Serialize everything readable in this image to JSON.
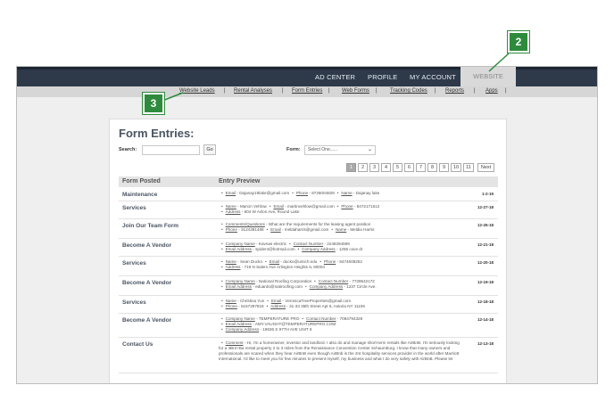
{
  "topnav": {
    "items": [
      "AD CENTER",
      "PROFILE",
      "MY ACCOUNT"
    ],
    "active": "WEBSITE"
  },
  "subnav": {
    "items": [
      "Website Leads",
      "Rental Analyses",
      "Form Entries",
      "Web Forms",
      "Tracking Codes",
      "Reports",
      "Apps"
    ]
  },
  "page": {
    "title": "Form Entries:",
    "search_label": "Search:",
    "search_value": "",
    "go_label": "Go",
    "form_label": "Form:",
    "form_select_value": "Select One......"
  },
  "pagination": {
    "pages": [
      "1",
      "2",
      "3",
      "4",
      "5",
      "6",
      "7",
      "8",
      "9",
      "10",
      "11"
    ],
    "current": "1",
    "next_label": "Next"
  },
  "table": {
    "headers": [
      "Form Posted",
      "Entry Preview"
    ],
    "rows": [
      {
        "type": "Maintenance",
        "date": "1-2-19",
        "lines": [
          [
            [
              "Email",
              "Dajanay19lake@gmail.com"
            ],
            [
              "Phone",
              "8726004828"
            ],
            [
              "Name",
              "Dajanay lake"
            ]
          ]
        ]
      },
      {
        "type": "Services",
        "date": "12-27-18",
        "lines": [
          [
            [
              "Name",
              "Marcin Vehlow"
            ],
            [
              "Email",
              "martinvehlow@gmail.com"
            ],
            [
              "Phone",
              "8472171512"
            ]
          ],
          [
            [
              "Address",
              "604 W Avlon Ave, Round Lake"
            ]
          ]
        ]
      },
      {
        "type": "Join Our Team Form",
        "date": "12-26-18",
        "lines": [
          [
            [
              "Comments/Questions",
              "What are the requirements for the leasing agent position"
            ]
          ],
          [
            [
              "Phone",
              "3124381488"
            ],
            [
              "Email",
              "meldaharris@gmail.com"
            ],
            [
              "Name",
              "Meldia Harris"
            ]
          ]
        ]
      },
      {
        "type": "Become A Vendor",
        "date": "12-21-18",
        "lines": [
          [
            [
              "Company Name",
              "Kavnas electric"
            ],
            [
              "Contact Number",
              "2248294599"
            ]
          ],
          [
            [
              "Email Address",
              "spider4@hotmail.com"
            ],
            [
              "Company Address",
              "1256 cove dr"
            ]
          ]
        ]
      },
      {
        "type": "Services",
        "date": "12-20-18",
        "lines": [
          [
            [
              "Name",
              "Sean Ducko"
            ],
            [
              "Email",
              "ducko@umich.edu"
            ],
            [
              "Phone",
              "8474608252"
            ]
          ],
          [
            [
              "Address",
              "719 N Salem Ave Arlington Heights IL 60004"
            ]
          ]
        ]
      },
      {
        "type": "Become A Vendor",
        "date": "12-19-18",
        "lines": [
          [
            [
              "Company Name",
              "National Roofing Corporation"
            ],
            [
              "Contact Number",
              "7739542172"
            ]
          ],
          [
            [
              "Email Address",
              "eduardo@natiroofing.com"
            ],
            [
              "Company Address",
              "1237 Circle Ave."
            ]
          ]
        ]
      },
      {
        "type": "Services",
        "date": "12-18-18",
        "lines": [
          [
            [
              "Name",
              "Christina Yun"
            ],
            [
              "Email",
              "VeronicaTreeProperties@gmail.com"
            ]
          ],
          [
            [
              "Phone",
              "5167297818"
            ],
            [
              "Address",
              "31-33 35th Street Apt 5, Astoria NY 11106"
            ]
          ]
        ]
      },
      {
        "type": "Become A Vendor",
        "date": "12-14-18",
        "lines": [
          [
            [
              "Company Name",
              "TEMPERATURE PRO"
            ],
            [
              "Contact Number",
              "7084794328"
            ]
          ],
          [
            [
              "Email Address",
              "AMY.VAUGHT@TEMPERATUREPRO.COM"
            ]
          ],
          [
            [
              "Company Address",
              "19636 S 97TH AVE UNIT 6"
            ]
          ]
        ]
      },
      {
        "type": "Contact Us",
        "date": "12-13-18",
        "lines": [
          [
            [
              "Comment",
              "Hi, I'm a homeowner, investor and landlord. I also do and manage short-term rentals like AirBnB. I'm seriously looking for a 4Br2+Ba rental property 2 to 3 miles from the Renaissance Convention Center Schaumburg. I know that many owners and professionals are scared when they hear AirBnB even though AirBnb is the 2nt hospitality services provider in the world after Marriott International. I'd like to meet you for few minutes to present myself, my business and what I do very safely with AirBnB. Please let"
            ]
          ]
        ]
      }
    ]
  },
  "callouts": {
    "website": "2",
    "website_leads": "3"
  },
  "colors": {
    "topnav": "#2e3a4a",
    "callout": "#2e8b3d",
    "accent_text": "#4a5563"
  }
}
